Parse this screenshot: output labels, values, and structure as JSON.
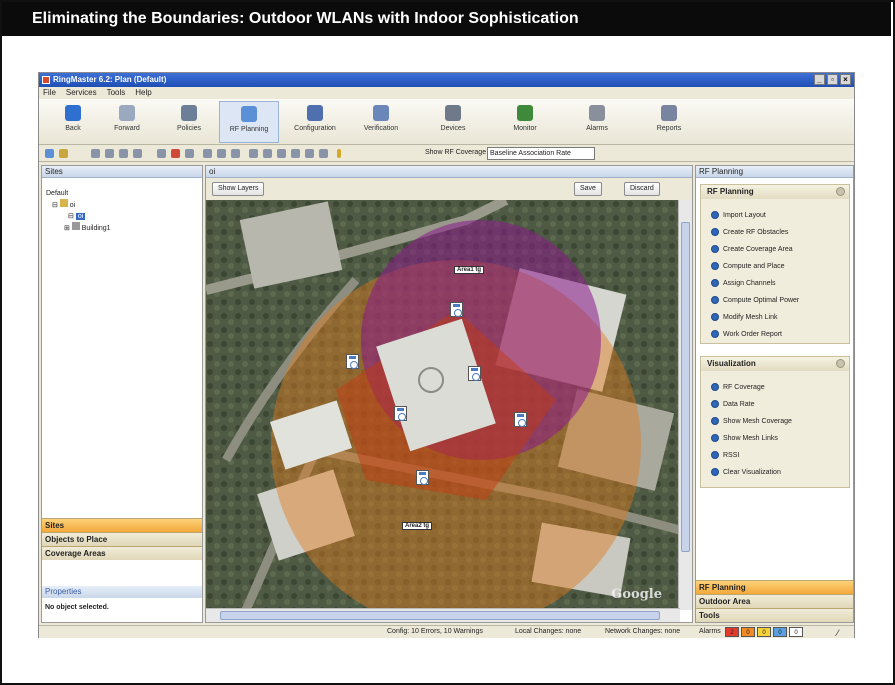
{
  "banner": {
    "title": "Eliminating the Boundaries: Outdoor WLANs with Indoor Sophistication"
  },
  "window": {
    "title": "RingMaster 6.2: Plan (Default)",
    "controls": [
      "_",
      "▫",
      "×"
    ]
  },
  "menu": [
    "File",
    "Services",
    "Tools",
    "Help"
  ],
  "toolbar": [
    {
      "label": "Back",
      "icon": "back-arrow-icon",
      "color": "#2f6fd0"
    },
    {
      "label": "Forward",
      "icon": "forward-arrow-icon",
      "color": "#9aa8c0"
    },
    {
      "label": "Policies",
      "icon": "policies-icon",
      "color": "#6d7f98"
    },
    {
      "label": "RF Planning",
      "icon": "rf-planning-icon",
      "color": "#5b8fd6",
      "active": true
    },
    {
      "label": "Configuration",
      "icon": "configuration-icon",
      "color": "#4f6fae"
    },
    {
      "label": "Verification",
      "icon": "verification-icon",
      "color": "#6b86b8"
    },
    {
      "label": "Devices",
      "icon": "devices-icon",
      "color": "#6e7a8a"
    },
    {
      "label": "Monitor",
      "icon": "monitor-icon",
      "color": "#3f8a3a"
    },
    {
      "label": "Alarms",
      "icon": "alarms-icon",
      "color": "#8a8f9c"
    },
    {
      "label": "Reports",
      "icon": "reports-icon",
      "color": "#7884a0"
    }
  ],
  "coverage": {
    "label": "Show RF Coverage using:",
    "value": "Baseline Association Rate"
  },
  "sites_panel": {
    "title": "Sites",
    "tree": [
      "Default",
      "oi",
      "oi",
      "Building1"
    ]
  },
  "accordion_left": [
    "Sites",
    "Objects to Place",
    "Coverage Areas"
  ],
  "properties": {
    "title": "Properties",
    "text": "No object selected."
  },
  "map_panel": {
    "tab": "oi",
    "show_layers": "Show Layers",
    "save": "Save",
    "discard": "Discard",
    "labels": [
      "Area1 tg",
      "Area2 tg"
    ],
    "watermark": "Google"
  },
  "rf_planning": {
    "panel_title": "RF Planning",
    "section_title": "RF Planning",
    "items": [
      "Import Layout",
      "Create RF Obstacles",
      "Create Coverage Area",
      "Compute and Place",
      "Assign Channels",
      "Compute Optimal Power",
      "Modify Mesh Link",
      "Work Order Report"
    ]
  },
  "visualization": {
    "section_title": "Visualization",
    "items": [
      "RF Coverage",
      "Data Rate",
      "Show Mesh Coverage",
      "Show Mesh Links",
      "RSSI",
      "Clear Visualization"
    ]
  },
  "accordion_right": [
    "RF Planning",
    "Outdoor Area",
    "Tools"
  ],
  "status": {
    "config": "Config: 10 Errors, 10 Warnings",
    "local": "Local Changes: none",
    "network": "Network Changes: none",
    "alarms_label": "Alarms",
    "alarm_counts": [
      "2",
      "0",
      "0",
      "0",
      "0"
    ],
    "alarm_colors": [
      "#e23b2e",
      "#f08a24",
      "#f5d23a",
      "#5aa0e0",
      "#ffffff"
    ]
  }
}
